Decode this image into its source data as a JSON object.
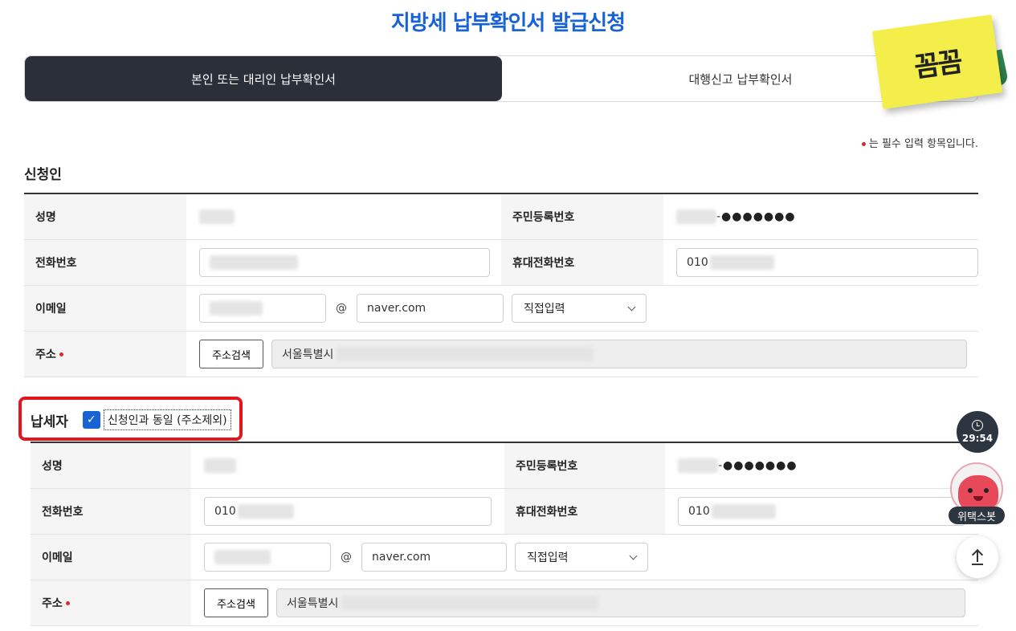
{
  "page_title": "지방세 납부확인서 발급신청",
  "tabs": [
    {
      "label": "본인 또는 대리인 납부확인서",
      "active": true
    },
    {
      "label": "대행신고 납부확인서",
      "active": false
    }
  ],
  "sticky_note": "꼼꼼",
  "required_note": "는 필수 입력 항목입니다.",
  "applicant": {
    "title": "신청인",
    "name_label": "성명",
    "rrn_label": "주민등록번호",
    "rrn_masked": "-●●●●●●●",
    "phone_label": "전화번호",
    "mobile_label": "휴대전화번호",
    "mobile_value": "010",
    "email_label": "이메일",
    "email_at": "@",
    "email_domain": "naver.com",
    "email_select": "직접입력",
    "address_label": "주소",
    "address_button": "주소검색",
    "address_value": "서울특별시"
  },
  "taxpayer": {
    "title": "납세자",
    "same_as_label": "신청인과 동일 (주소제외)",
    "name_label": "성명",
    "rrn_label": "주민등록번호",
    "rrn_masked": "-●●●●●●●",
    "phone_label": "전화번호",
    "phone_value": "010",
    "mobile_label": "휴대전화번호",
    "mobile_value": "010",
    "email_label": "이메일",
    "email_at": "@",
    "email_domain": "naver.com",
    "email_select": "직접입력",
    "address_label": "주소",
    "address_button": "주소검색",
    "address_value": "서울특별시"
  },
  "floating": {
    "timer": "29:54",
    "bot_label": "위택스봇"
  },
  "colors": {
    "title_blue": "#1763d6",
    "tab_active_bg": "#2b2f3a",
    "required_red": "#d62b2b",
    "highlight_red": "#e3151f",
    "sticky_yellow": "#f3ee49"
  }
}
